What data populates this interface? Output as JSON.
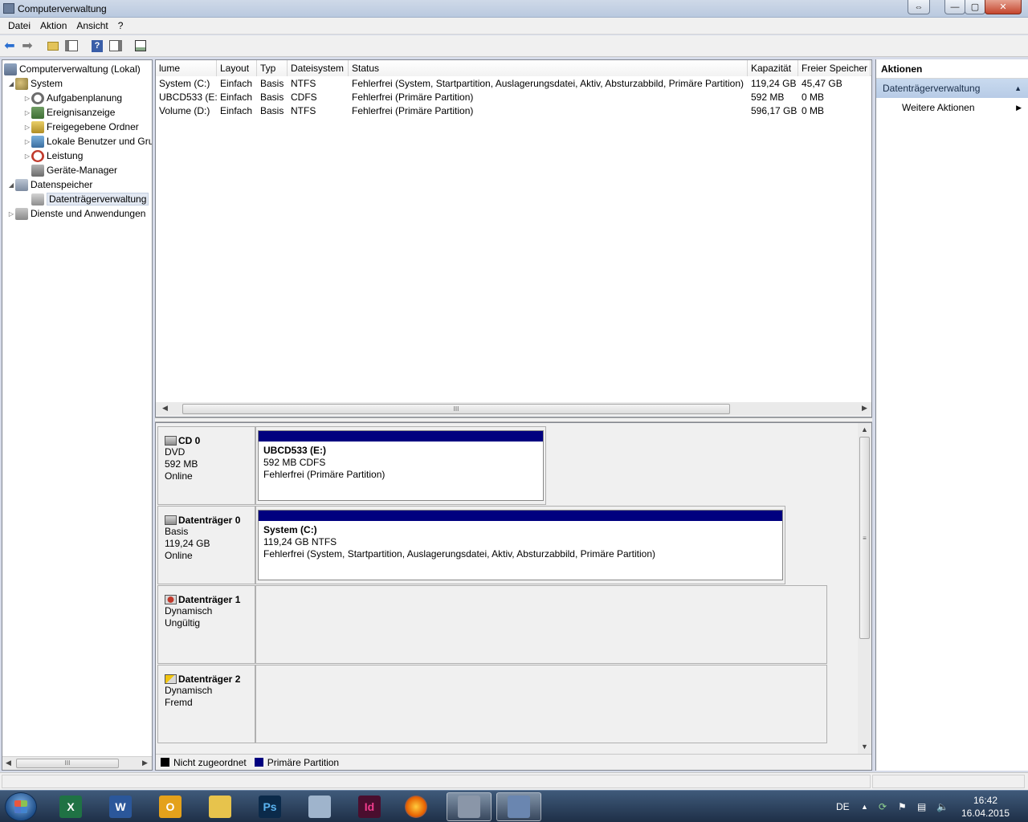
{
  "window": {
    "title": "Computerverwaltung",
    "buttons": {
      "swap": "⇔",
      "minimize": "—",
      "maximize": "▢",
      "close": "✕"
    }
  },
  "menu": [
    "Datei",
    "Aktion",
    "Ansicht",
    "?"
  ],
  "toolbar": {
    "icons": [
      "back-icon",
      "forward-icon",
      "up-folder-icon",
      "show-tree-icon",
      "help-icon",
      "show-action-pane-icon",
      "properties-icon"
    ],
    "help_label": "?"
  },
  "tree": {
    "root": "Computerverwaltung (Lokal)",
    "system": "System",
    "aufgabenplanung": "Aufgabenplanung",
    "ereignisanzeige": "Ereignisanzeige",
    "freigegebene_ordner": "Freigegebene Ordner",
    "lokale_benutzer": "Lokale Benutzer und Gru",
    "leistung": "Leistung",
    "geraete_manager": "Geräte-Manager",
    "datenspeicher": "Datenspeicher",
    "datentraegerverwaltung": "Datenträgerverwaltung",
    "dienste": "Dienste und Anwendungen"
  },
  "volume_list": {
    "columns": [
      "lume",
      "Layout",
      "Typ",
      "Dateisystem",
      "Status",
      "Kapazität",
      "Freier Speicher"
    ],
    "rows": [
      [
        "System (C:)",
        "Einfach",
        "Basis",
        "NTFS",
        "Fehlerfrei (System, Startpartition, Auslagerungsdatei, Aktiv, Absturzabbild, Primäre Partition)",
        "119,24 GB",
        "45,47 GB"
      ],
      [
        "UBCD533 (E:)",
        "Einfach",
        "Basis",
        "CDFS",
        "Fehlerfrei (Primäre Partition)",
        "592 MB",
        "0 MB"
      ],
      [
        "Volume (D:)",
        "Einfach",
        "Basis",
        "NTFS",
        "Fehlerfrei (Primäre Partition)",
        "596,17 GB",
        "0 MB"
      ]
    ],
    "hscroll_grip": "III"
  },
  "disks": [
    {
      "name": "CD 0",
      "type": "DVD",
      "size": "592 MB",
      "state": "Online",
      "partition": {
        "title": "UBCD533  (E:)",
        "detail": "592 MB CDFS",
        "status": "Fehlerfrei (Primäre Partition)"
      }
    },
    {
      "name": "Datenträger 0",
      "type": "Basis",
      "size": "119,24 GB",
      "state": "Online",
      "partition": {
        "title": "System  (C:)",
        "detail": "119,24 GB NTFS",
        "status": "Fehlerfrei (System, Startpartition, Auslagerungsdatei, Aktiv, Absturzabbild, Primäre Partition)"
      }
    },
    {
      "name": "Datenträger 1",
      "type": "Dynamisch",
      "size": "",
      "state": "Ungültig"
    },
    {
      "name": "Datenträger 2",
      "type": "Dynamisch",
      "size": "",
      "state": "Fremd"
    }
  ],
  "legend": [
    {
      "label": "Nicht zugeordnet",
      "color": "#000000"
    },
    {
      "label": "Primäre Partition",
      "color": "#00007f"
    }
  ],
  "actions": {
    "title": "Aktionen",
    "section": "Datenträgerverwaltung",
    "items": [
      "Weitere Aktionen"
    ]
  },
  "taskbar": {
    "apps": [
      {
        "name": "excel",
        "label": "X",
        "color": "#1f7244"
      },
      {
        "name": "word",
        "label": "W",
        "color": "#2b579a"
      },
      {
        "name": "outlook",
        "label": "O",
        "color": "#e4a11b"
      },
      {
        "name": "explorer",
        "label": "",
        "color": "#e7c34c"
      },
      {
        "name": "photoshop",
        "label": "Ps",
        "color": "#0b2a4a"
      },
      {
        "name": "calculator",
        "label": "",
        "color": "#9fb4cc"
      },
      {
        "name": "indesign",
        "label": "Id",
        "color": "#4a0e2e"
      },
      {
        "name": "firefox",
        "label": "",
        "color": "#e66000"
      },
      {
        "name": "disk-app",
        "label": "",
        "color": "#8a96a8"
      },
      {
        "name": "computer-management",
        "label": "",
        "color": "#6a86b0"
      }
    ],
    "language": "DE",
    "time": "16:42",
    "date": "16.04.2015"
  }
}
